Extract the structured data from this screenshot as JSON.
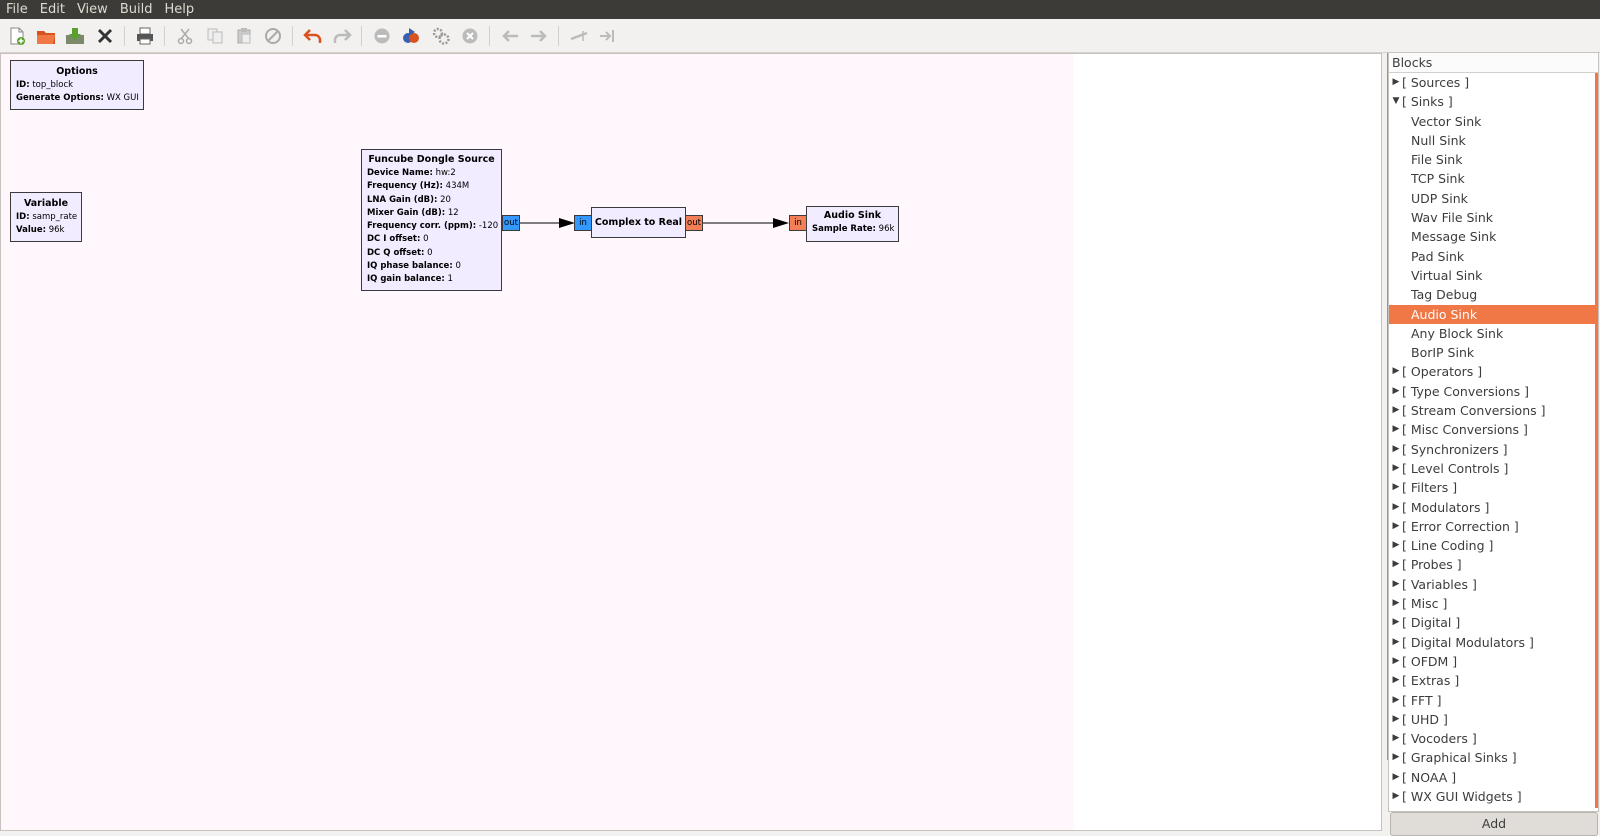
{
  "menubar": {
    "items": [
      "File",
      "Edit",
      "View",
      "Build",
      "Help"
    ]
  },
  "toolbar": {
    "buttons": [
      {
        "icon": "new-document-icon",
        "enabled": true
      },
      {
        "icon": "open-folder-icon",
        "enabled": true
      },
      {
        "icon": "save-icon",
        "enabled": true
      },
      {
        "icon": "close-icon",
        "enabled": true
      },
      {
        "icon": "print-icon",
        "enabled": true
      },
      {
        "icon": "cut-icon",
        "enabled": false
      },
      {
        "icon": "copy-icon",
        "enabled": false
      },
      {
        "icon": "paste-icon",
        "enabled": false
      },
      {
        "icon": "delete-icon",
        "enabled": false
      },
      {
        "icon": "undo-icon",
        "enabled": true
      },
      {
        "icon": "redo-icon",
        "enabled": false
      },
      {
        "icon": "generate-icon",
        "enabled": false
      },
      {
        "icon": "execute-icon",
        "enabled": true
      },
      {
        "icon": "kill-icon",
        "enabled": false
      },
      {
        "icon": "stop-icon",
        "enabled": false
      },
      {
        "icon": "rotate-ccw-icon",
        "enabled": false
      },
      {
        "icon": "rotate-cw-icon",
        "enabled": false
      },
      {
        "icon": "enable-icon",
        "enabled": false
      },
      {
        "icon": "disable-icon",
        "enabled": false
      }
    ]
  },
  "flowgraph": {
    "options_block": {
      "title": "Options",
      "params": [
        {
          "key": "ID:",
          "value": "top_block"
        },
        {
          "key": "Generate Options:",
          "value": "WX GUI"
        }
      ]
    },
    "variable_block": {
      "title": "Variable",
      "params": [
        {
          "key": "ID:",
          "value": "samp_rate"
        },
        {
          "key": "Value:",
          "value": "96k"
        }
      ]
    },
    "fcd_block": {
      "title": "Funcube Dongle Source",
      "params": [
        {
          "key": "Device Name:",
          "value": "hw:2"
        },
        {
          "key": "Frequency (Hz):",
          "value": "434M"
        },
        {
          "key": "LNA Gain (dB):",
          "value": "20"
        },
        {
          "key": "Mixer Gain (dB):",
          "value": "12"
        },
        {
          "key": "Frequency corr. (ppm):",
          "value": "-120"
        },
        {
          "key": "DC I offset:",
          "value": "0"
        },
        {
          "key": "DC Q offset:",
          "value": "0"
        },
        {
          "key": "IQ phase balance:",
          "value": "0"
        },
        {
          "key": "IQ gain balance:",
          "value": "1"
        }
      ],
      "out_port": "out"
    },
    "c2r_block": {
      "title": "Complex to Real",
      "in_port": "in",
      "out_port": "out"
    },
    "audio_sink_block": {
      "title": "Audio Sink",
      "params": [
        {
          "key": "Sample Rate:",
          "value": "96k"
        }
      ],
      "in_port": "in"
    },
    "colors": {
      "complex_port": "#3399ff",
      "float_port": "#f37f57",
      "block_bg": "#f1ecff",
      "canvas_bg": "#fff7fc"
    }
  },
  "blocks_panel": {
    "header": "Blocks",
    "tree": [
      {
        "label": "[ Sources ]",
        "type": "cat",
        "expanded": false
      },
      {
        "label": "[ Sinks ]",
        "type": "cat",
        "expanded": true
      },
      {
        "label": "Vector Sink",
        "type": "leaf"
      },
      {
        "label": "Null Sink",
        "type": "leaf"
      },
      {
        "label": "File Sink",
        "type": "leaf"
      },
      {
        "label": "TCP Sink",
        "type": "leaf"
      },
      {
        "label": "UDP Sink",
        "type": "leaf"
      },
      {
        "label": "Wav File Sink",
        "type": "leaf"
      },
      {
        "label": "Message Sink",
        "type": "leaf"
      },
      {
        "label": "Pad Sink",
        "type": "leaf"
      },
      {
        "label": "Virtual Sink",
        "type": "leaf"
      },
      {
        "label": "Tag Debug",
        "type": "leaf"
      },
      {
        "label": "Audio Sink",
        "type": "leaf",
        "selected": true
      },
      {
        "label": "Any Block Sink",
        "type": "leaf"
      },
      {
        "label": "BorIP Sink",
        "type": "leaf"
      },
      {
        "label": "[ Operators ]",
        "type": "cat",
        "expanded": false
      },
      {
        "label": "[ Type Conversions ]",
        "type": "cat",
        "expanded": false
      },
      {
        "label": "[ Stream Conversions ]",
        "type": "cat",
        "expanded": false
      },
      {
        "label": "[ Misc Conversions ]",
        "type": "cat",
        "expanded": false
      },
      {
        "label": "[ Synchronizers ]",
        "type": "cat",
        "expanded": false
      },
      {
        "label": "[ Level Controls ]",
        "type": "cat",
        "expanded": false
      },
      {
        "label": "[ Filters ]",
        "type": "cat",
        "expanded": false
      },
      {
        "label": "[ Modulators ]",
        "type": "cat",
        "expanded": false
      },
      {
        "label": "[ Error Correction ]",
        "type": "cat",
        "expanded": false
      },
      {
        "label": "[ Line Coding ]",
        "type": "cat",
        "expanded": false
      },
      {
        "label": "[ Probes ]",
        "type": "cat",
        "expanded": false
      },
      {
        "label": "[ Variables ]",
        "type": "cat",
        "expanded": false
      },
      {
        "label": "[ Misc ]",
        "type": "cat",
        "expanded": false
      },
      {
        "label": "[ Digital ]",
        "type": "cat",
        "expanded": false
      },
      {
        "label": "[ Digital Modulators ]",
        "type": "cat",
        "expanded": false
      },
      {
        "label": "[ OFDM ]",
        "type": "cat",
        "expanded": false
      },
      {
        "label": "[ Extras ]",
        "type": "cat",
        "expanded": false
      },
      {
        "label": "[ FFT ]",
        "type": "cat",
        "expanded": false
      },
      {
        "label": "[ UHD ]",
        "type": "cat",
        "expanded": false
      },
      {
        "label": "[ Vocoders ]",
        "type": "cat",
        "expanded": false
      },
      {
        "label": "[ Graphical Sinks ]",
        "type": "cat",
        "expanded": false
      },
      {
        "label": "[ NOAA ]",
        "type": "cat",
        "expanded": false
      },
      {
        "label": "[ WX GUI Widgets ]",
        "type": "cat",
        "expanded": false
      }
    ],
    "add_button": "Add",
    "accent": "#f07746"
  }
}
